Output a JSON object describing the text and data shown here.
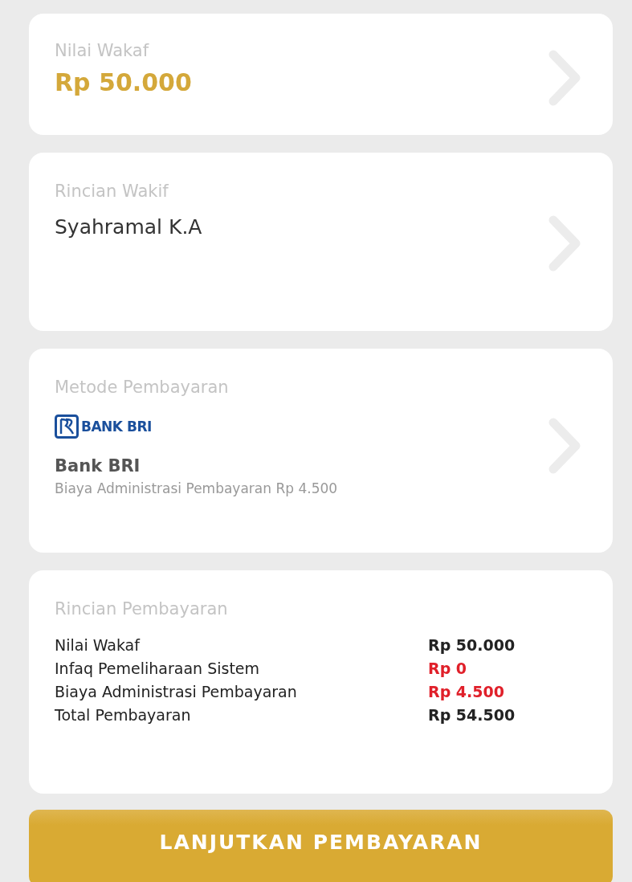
{
  "wakaf_value": {
    "label": "Nilai Wakaf",
    "amount": "Rp 50.000"
  },
  "wakif_details": {
    "label": "Rincian Wakif",
    "name": "Syahramal K.A"
  },
  "payment_method": {
    "label": "Metode Pembayaran",
    "logo_text": "BANK BRI",
    "bank_name": "Bank BRI",
    "fee_note": "Biaya Administrasi Pembayaran Rp 4.500"
  },
  "payment_details": {
    "label": "Rincian Pembayaran",
    "rows": [
      {
        "label": "Nilai Wakaf",
        "value": "Rp 50.000",
        "color": "#222222"
      },
      {
        "label": "Infaq Pemeliharaan Sistem",
        "value": "Rp 0",
        "color": "#e0202a"
      },
      {
        "label": "Biaya Administrasi Pembayaran",
        "value": "Rp 4.500",
        "color": "#e0202a"
      },
      {
        "label": "Total Pembayaran",
        "value": "Rp 54.500",
        "color": "#222222"
      }
    ]
  },
  "continue_button": "LANJUTKAN PEMBAYARAN"
}
